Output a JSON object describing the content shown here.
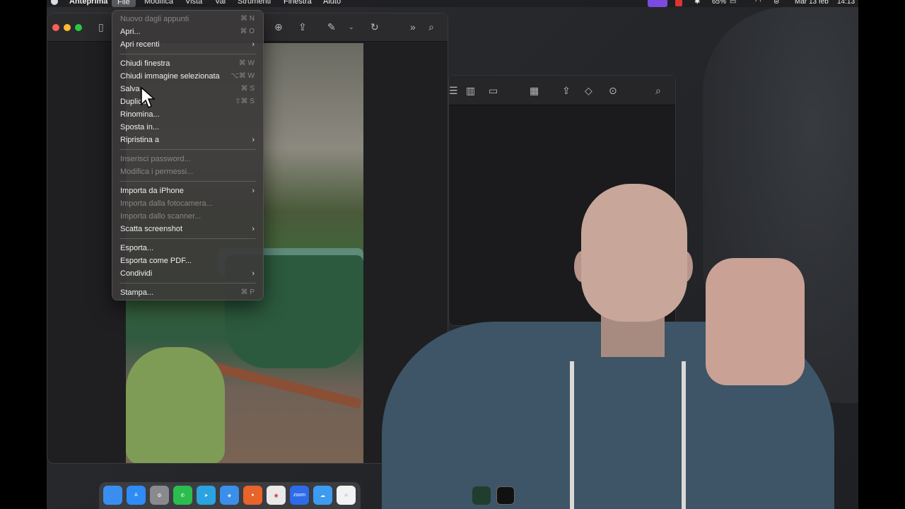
{
  "menubar": {
    "app_name": "Anteprima",
    "items": [
      "File",
      "Modifica",
      "Vista",
      "Vai",
      "Strumenti",
      "Finestra",
      "Aiuto"
    ],
    "active_item": "File",
    "battery": "65%",
    "date": "Mar 13 feb",
    "time": "14:13"
  },
  "file_menu": {
    "items": [
      {
        "label": "Nuovo dagli appunti",
        "shortcut": "⌘ N",
        "disabled": true
      },
      {
        "label": "Apri...",
        "shortcut": "⌘ O",
        "disabled": false
      },
      {
        "label": "Apri recenti",
        "submenu": true
      },
      {
        "label": "Chiudi finestra",
        "shortcut": "⌘ W",
        "disabled": false
      },
      {
        "label": "Chiudi immagine selezionata",
        "shortcut": "⌥⌘ W",
        "disabled": false
      },
      {
        "label": "Salva",
        "shortcut": "⌘ S",
        "disabled": false
      },
      {
        "label": "Duplica",
        "shortcut": "⇧⌘ S",
        "disabled": false
      },
      {
        "label": "Rinomina...",
        "disabled": false
      },
      {
        "label": "Sposta in...",
        "disabled": false
      },
      {
        "label": "Ripristina a",
        "submenu": true
      },
      {
        "label": "Inserisci password...",
        "disabled": true
      },
      {
        "label": "Modifica i permessi...",
        "disabled": true
      },
      {
        "label": "Importa da iPhone",
        "submenu": true
      },
      {
        "label": "Importa dalla fotocamera...",
        "disabled": true
      },
      {
        "label": "Importa dallo scanner...",
        "disabled": true
      },
      {
        "label": "Scatta screenshot",
        "submenu": true
      },
      {
        "label": "Esporta...",
        "disabled": false
      },
      {
        "label": "Esporta come PDF...",
        "disabled": false
      },
      {
        "label": "Condividi",
        "submenu": true
      },
      {
        "label": "Stampa...",
        "shortcut": "⌘ P",
        "disabled": false
      }
    ]
  },
  "dock": {
    "apps": [
      "finder-icon",
      "app-store-icon",
      "settings-icon",
      "whatsapp-icon",
      "telegram-icon",
      "safari-icon",
      "firefox-icon",
      "chrome-icon",
      "zoom-icon",
      "weather-icon",
      "home-icon"
    ],
    "zoom_label": "zoom"
  },
  "colors": {
    "menubar_active": "#5a5c60",
    "purple_badge": "#7b4ae0"
  }
}
